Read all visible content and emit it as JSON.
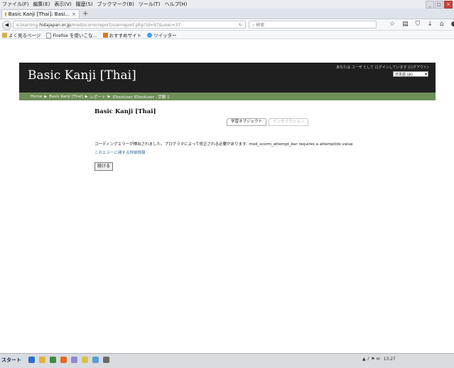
{
  "browser": {
    "menu": [
      "ファイル(F)",
      "編集(E)",
      "表示(V)",
      "履歴(S)",
      "ブックマーク(B)",
      "ツール(T)",
      "ヘルプ(H)"
    ],
    "tab_title": "Basic Kanji [Thai]: Basi...",
    "url_prefix": "e-learning.",
    "url_domain": "hidajapan.or.jp",
    "url_rest": "/mod/scorm/report/userreport.php?id=97&user=37",
    "search_placeholder": "検索",
    "bookmarks": [
      "よく見るページ",
      "Firefox を使いこな...",
      "おすすめサイト",
      "ツイッター"
    ]
  },
  "page": {
    "site_title": "Basic Kanji [Thai]",
    "login_text": "あなたは ユーザ として ログインしています (ログアウト)",
    "language": "日本語 (ja)",
    "breadcrumb": [
      "Home",
      "Basic Kanji [Thai]",
      "レポート",
      "IDtestuser IDtestuser - 受験 1"
    ],
    "course_title": "Basic Kanji [Thai]",
    "tabs": [
      "学習オブジェクト",
      "インタラクション"
    ],
    "error_message": "コーディングエラーが検出されました。プログラマによって修正される必要があります: mod_scorm_attempt_bar requires a attemptids value",
    "more_info_link": "このエラーに関する詳細情報",
    "continue_label": "続ける"
  },
  "taskbar": {
    "start_label": "スタート",
    "tray_text": "13:27"
  },
  "colors": {
    "header_bg": "#1f1f1f",
    "nav_green": "#6e8f58",
    "link_blue": "#3a6ea5"
  }
}
